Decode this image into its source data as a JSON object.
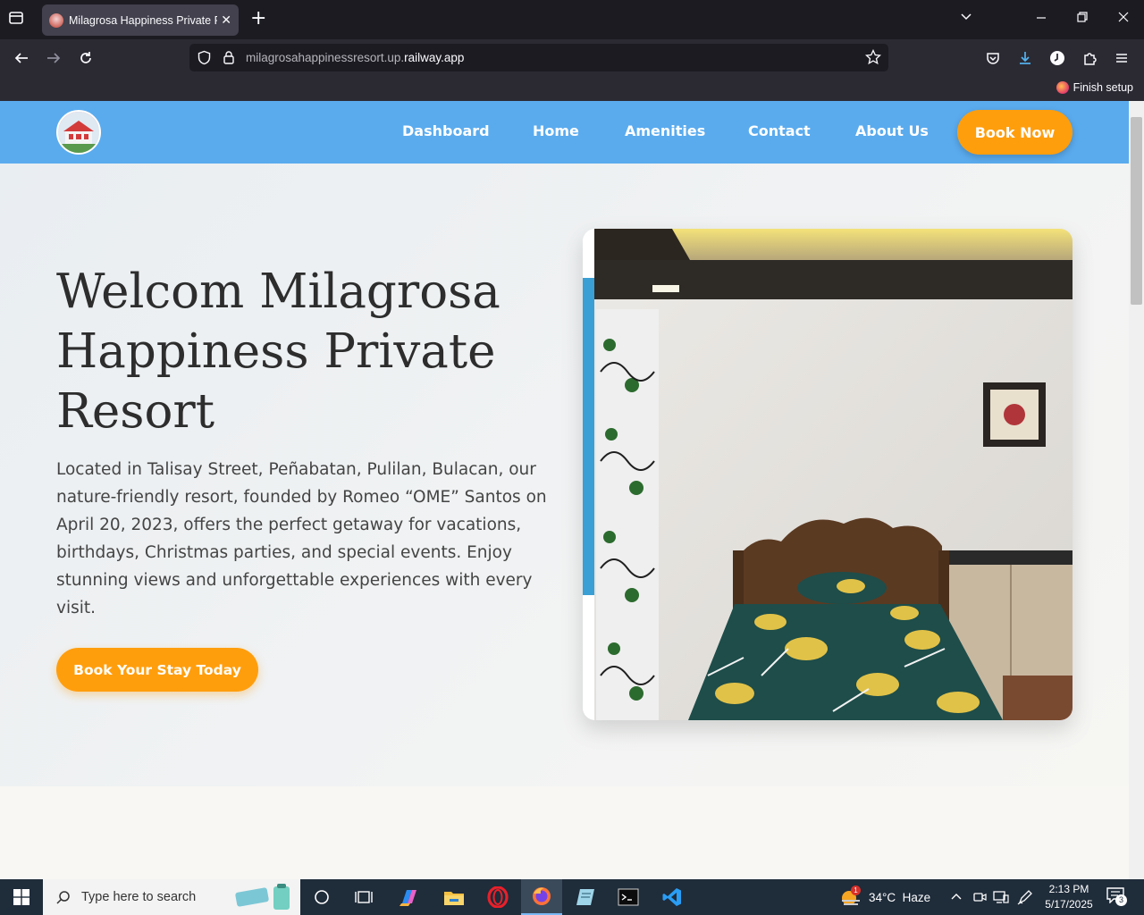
{
  "browser": {
    "tab_title": "Milagrosa Happiness Private Re",
    "url_prefix": "milagrosahappinessresort.up.",
    "url_domain": "railway.app",
    "finish_setup": "Finish setup"
  },
  "site": {
    "menu": [
      "Dashboard",
      "Home",
      "Amenities",
      "Contact",
      "About Us"
    ],
    "book_now": "Book Now",
    "hero_title": "Welcom Milagrosa Happiness Private Resort",
    "hero_text": "Located in Talisay Street, Peñabatan, Pulilan, Bulacan, our nature-friendly resort, founded by Romeo “OME” Santos on April 20, 2023, offers the perfect getaway for vacations, birthdays, Christmas parties, and special events. Enjoy stunning views and unforgettable experiences with every visit.",
    "cta": "Book Your Stay Today",
    "accent": "#ff9e0d",
    "header_color": "#5aabee"
  },
  "taskbar": {
    "search_placeholder": "Type here to search",
    "weather": "34°C  Haze",
    "time": "2:13 PM",
    "date": "5/17/2025",
    "notifications": "3",
    "weather_badge": "1"
  }
}
